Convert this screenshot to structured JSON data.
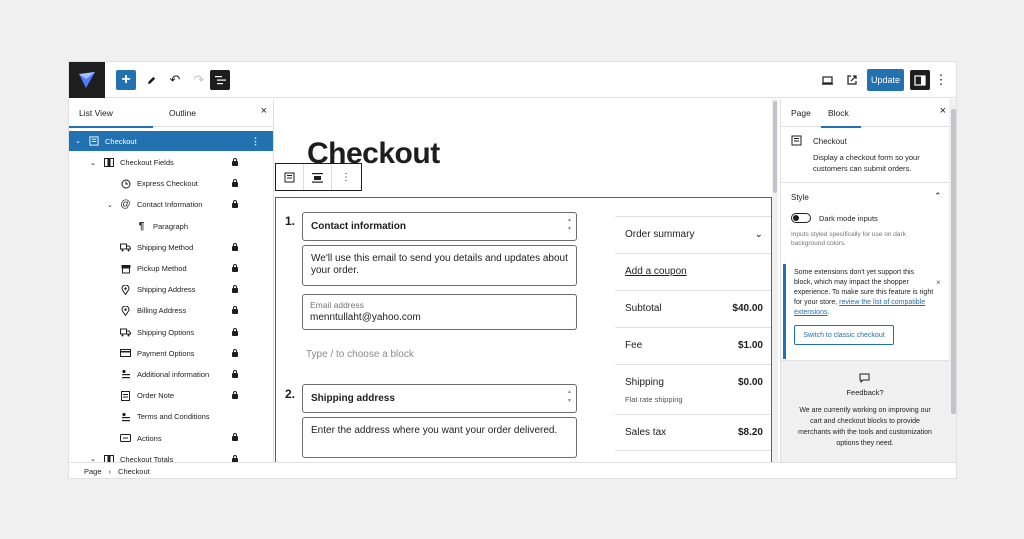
{
  "toolbar": {
    "update_label": "Update",
    "add_icon": "+",
    "more_icon": "⋮"
  },
  "left_panel": {
    "tab_list": "List View",
    "tab_outline": "Outline",
    "close": "×",
    "tree": [
      {
        "label": "Checkout",
        "icon": "checkout-icon",
        "chevron": "⌄",
        "depth": 0,
        "selected": true
      },
      {
        "label": "Checkout Fields",
        "icon": "columns-icon",
        "chevron": "⌄",
        "depth": 1,
        "locked": true
      },
      {
        "label": "Express Checkout",
        "icon": "clock-icon",
        "depth": 2,
        "locked": true
      },
      {
        "label": "Contact Information",
        "icon": "at-icon",
        "chevron": "⌄",
        "depth": 2,
        "locked": true
      },
      {
        "label": "Paragraph",
        "icon": "paragraph-icon",
        "depth": 3
      },
      {
        "label": "Shipping Method",
        "icon": "truck-icon",
        "depth": 2,
        "locked": true
      },
      {
        "label": "Pickup Method",
        "icon": "store-icon",
        "depth": 2,
        "locked": true
      },
      {
        "label": "Shipping Address",
        "icon": "pin-icon",
        "depth": 2,
        "locked": true
      },
      {
        "label": "Billing Address",
        "icon": "pin-icon",
        "depth": 2,
        "locked": true
      },
      {
        "label": "Shipping Options",
        "icon": "truck-icon",
        "depth": 2,
        "locked": true
      },
      {
        "label": "Payment Options",
        "icon": "card-icon",
        "depth": 2,
        "locked": true
      },
      {
        "label": "Additional information",
        "icon": "person-icon",
        "depth": 2,
        "locked": true
      },
      {
        "label": "Order Note",
        "icon": "note-icon",
        "depth": 2,
        "locked": true
      },
      {
        "label": "Terms and Conditions",
        "icon": "person-icon",
        "depth": 2
      },
      {
        "label": "Actions",
        "icon": "button-icon",
        "depth": 2,
        "locked": true
      },
      {
        "label": "Checkout Totals",
        "icon": "columns-icon",
        "chevron": "⌄",
        "depth": 1,
        "locked": true
      }
    ]
  },
  "canvas": {
    "page_title": "Checkout",
    "step1_num": "1.",
    "step1_title": "Contact information",
    "step1_desc": "We'll use this email to send you details and updates about your order.",
    "email_label": "Email address",
    "email_value": "menntullaht@yahoo.com",
    "type_hint": "Type / to choose a block",
    "step2_num": "2.",
    "step2_title": "Shipping address",
    "step2_desc": "Enter the address where you want your order delivered.",
    "summary": {
      "title": "Order summary",
      "coupon": "Add a coupon",
      "rows": [
        {
          "label": "Subtotal",
          "value": "$40.00"
        },
        {
          "label": "Fee",
          "value": "$1.00"
        },
        {
          "label": "Shipping",
          "value": "$0.00",
          "sub": "Flat rate shipping"
        },
        {
          "label": "Sales tax",
          "value": "$8.20"
        }
      ]
    }
  },
  "right_panel": {
    "tab_page": "Page",
    "tab_block": "Block",
    "close": "×",
    "block_name": "Checkout",
    "block_desc": "Display a checkout form so your customers can submit orders.",
    "style_title": "Style",
    "toggle_label": "Dark mode inputs",
    "toggle_help": "Inputs styled specifically for use on dark background colors.",
    "notice_text_pre": "Some extensions don't yet support this block, which may impact the shopper experience. To make sure this feature is right for your store, ",
    "notice_link": "review the list of compatible extensions",
    "notice_text_post": ".",
    "classic_button": "Switch to classic checkout",
    "feedback_title": "Feedback?",
    "feedback_text": "We are currently working on improving our cart and checkout blocks to provide merchants with the tools and customization options they need."
  },
  "breadcrumb": {
    "root": "Page",
    "separator": "›",
    "current": "Checkout"
  }
}
